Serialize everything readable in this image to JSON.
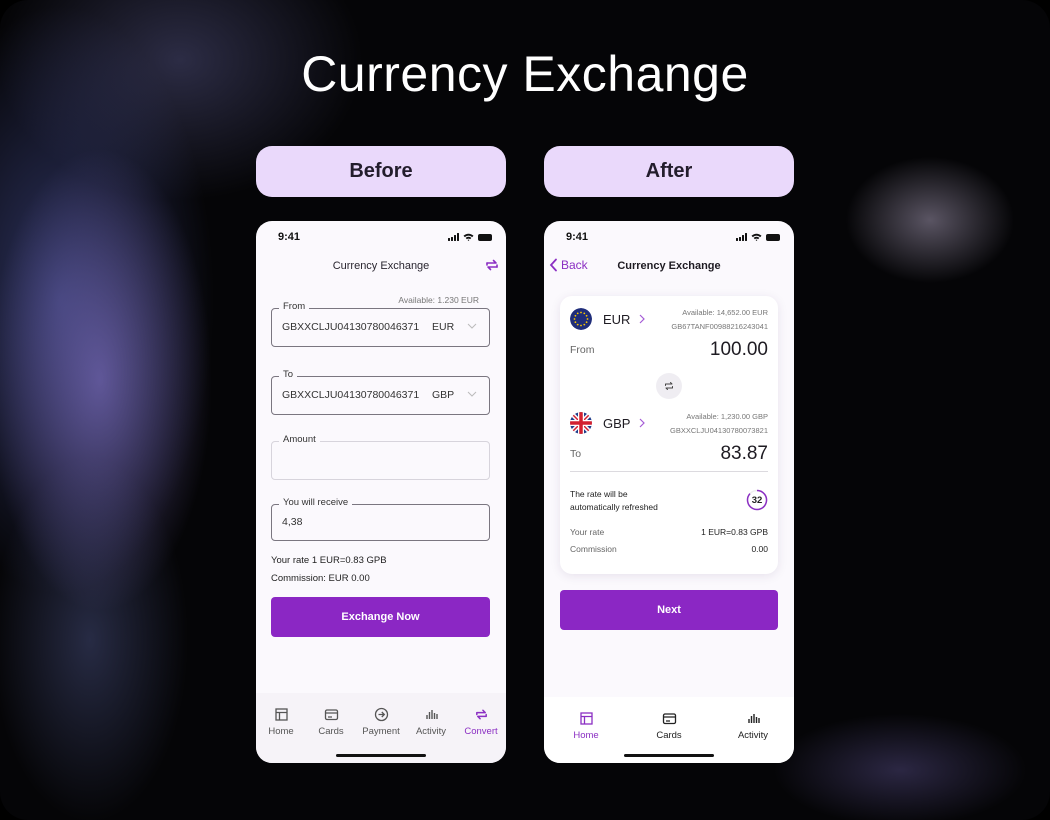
{
  "page": {
    "title": "Currency Exchange",
    "before_label": "Before",
    "after_label": "After"
  },
  "colors": {
    "accent": "#8b27c4",
    "pill_bg": "#ead9fb"
  },
  "before": {
    "status_time": "9:41",
    "nav_title": "Currency Exchange",
    "swap_icon": "swap-arrows-icon",
    "available": "Available: 1.230 EUR",
    "from": {
      "label": "From",
      "account": "GBXXCLJU04130780046371",
      "currency": "EUR"
    },
    "to": {
      "label": "To",
      "account": "GBXXCLJU04130780046371",
      "currency": "GBP"
    },
    "amount": {
      "label": "Amount",
      "value": ""
    },
    "receive": {
      "label": "You will receive",
      "value": "4,38"
    },
    "rate_line": "Your rate 1 EUR=0.83 GPB",
    "commission_line": "Commission: EUR 0.00",
    "button": "Exchange Now",
    "tabs": [
      {
        "label": "Home",
        "icon": "home-layout-icon",
        "active": false
      },
      {
        "label": "Cards",
        "icon": "card-icon",
        "active": false
      },
      {
        "label": "Payment",
        "icon": "arrow-circle-icon",
        "active": false
      },
      {
        "label": "Activity",
        "icon": "bar-chart-icon",
        "active": false
      },
      {
        "label": "Convert",
        "icon": "swap-arrows-icon",
        "active": true
      }
    ]
  },
  "after": {
    "status_time": "9:41",
    "back_label": "Back",
    "nav_title": "Currency Exchange",
    "from": {
      "currency": "EUR",
      "flag": "eu-flag",
      "available": "Available: 14,652.00 EUR",
      "account": "GB67TANF00988216243041",
      "label": "From",
      "amount": "100.00"
    },
    "to": {
      "currency": "GBP",
      "flag": "uk-flag",
      "available": "Available: 1,230.00 GBP",
      "account": "GBXXCLJU04130780073821",
      "label": "To",
      "amount": "83.87"
    },
    "refresh_text_1": "The rate will be",
    "refresh_text_2": "automatically refreshed",
    "timer": "32",
    "rate_label": "Your rate",
    "rate_value": "1 EUR=0.83 GPB",
    "commission_label": "Commission",
    "commission_value": "0.00",
    "button": "Next",
    "tabs": [
      {
        "label": "Home",
        "icon": "home-layout-icon",
        "active": true
      },
      {
        "label": "Cards",
        "icon": "card-icon",
        "active": false
      },
      {
        "label": "Activity",
        "icon": "bar-chart-icon",
        "active": false
      }
    ]
  }
}
